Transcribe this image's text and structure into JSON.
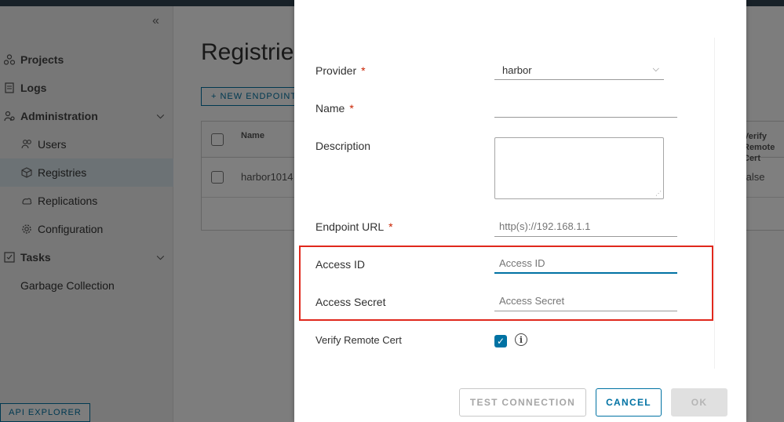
{
  "sidenav": {
    "collapse_icon": "double-chevron-left-icon",
    "items": [
      {
        "label": "Projects",
        "icon": "projects-icon"
      },
      {
        "label": "Logs",
        "icon": "logs-icon"
      },
      {
        "label": "Administration",
        "icon": "administration-icon"
      },
      {
        "label": "Users",
        "icon": "users-icon"
      },
      {
        "label": "Registries",
        "icon": "registries-icon"
      },
      {
        "label": "Replications",
        "icon": "replications-icon"
      },
      {
        "label": "Configuration",
        "icon": "configuration-icon"
      },
      {
        "label": "Tasks",
        "icon": "tasks-icon"
      },
      {
        "label": "Garbage Collection"
      }
    ],
    "api_explorer": "API EXPLORER"
  },
  "main": {
    "title": "Registries",
    "new_endpoint": "+ NEW ENDPOINT",
    "grid": {
      "columns": [
        "Name",
        "Verify Remote Cert"
      ],
      "rows": [
        {
          "name": "harbor1014",
          "verify": "false"
        }
      ]
    }
  },
  "modal": {
    "provider": {
      "label": "Provider",
      "required": "*",
      "value": "harbor"
    },
    "name": {
      "label": "Name",
      "required": "*",
      "value": ""
    },
    "description": {
      "label": "Description",
      "value": ""
    },
    "endpoint_url": {
      "label": "Endpoint URL",
      "required": "*",
      "placeholder": "http(s)://192.168.1.1"
    },
    "access_id": {
      "label": "Access ID",
      "placeholder": "Access ID"
    },
    "access_secret": {
      "label": "Access Secret",
      "placeholder": "Access Secret"
    },
    "verify_cert": {
      "label": "Verify Remote Cert",
      "checked": true,
      "info_icon": "i"
    },
    "buttons": {
      "test": "TEST CONNECTION",
      "cancel": "CANCEL",
      "ok": "OK"
    }
  },
  "colors": {
    "accent": "#0072a3",
    "required": "#c92100",
    "highlight": "#e0281c"
  }
}
